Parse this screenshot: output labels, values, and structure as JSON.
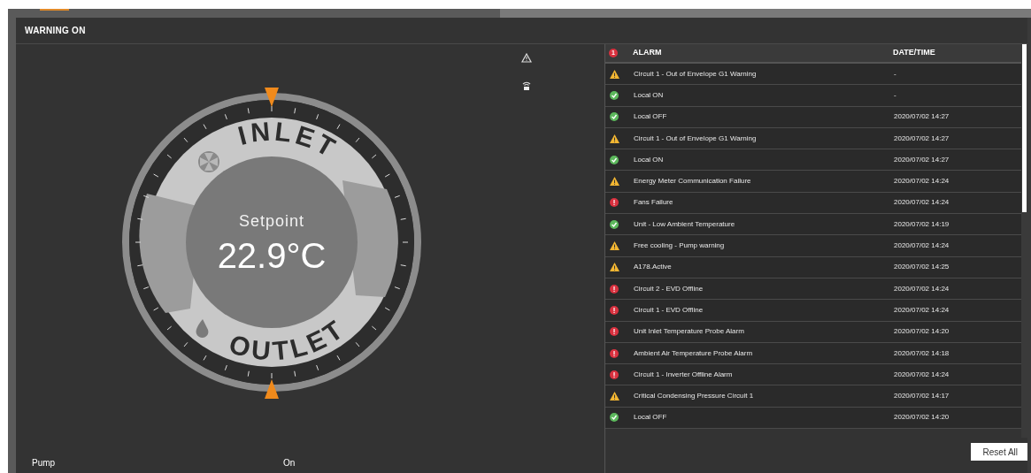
{
  "header": {
    "title": "WARNING ON"
  },
  "gauge": {
    "label": "Setpoint",
    "value": "22.9°C",
    "inlet": "INLET",
    "outlet": "OUTLET"
  },
  "status": {
    "label": "Pump",
    "value": "On"
  },
  "alarms": {
    "badge": "1",
    "columns": [
      "ALARM",
      "DATE/TIME"
    ],
    "rows": [
      {
        "kind": "warning",
        "alarm": "Circuit 1 - Out of Envelope G1 Warning",
        "time": "-"
      },
      {
        "kind": "ok",
        "alarm": "Local ON",
        "time": "-"
      },
      {
        "kind": "ok",
        "alarm": "Local OFF",
        "time": "2020/07/02 14:27"
      },
      {
        "kind": "warning",
        "alarm": "Circuit 1 - Out of Envelope G1 Warning",
        "time": "2020/07/02 14:27"
      },
      {
        "kind": "ok",
        "alarm": "Local ON",
        "time": "2020/07/02 14:27"
      },
      {
        "kind": "warning",
        "alarm": "Energy Meter Communication Failure",
        "time": "2020/07/02 14:24"
      },
      {
        "kind": "error",
        "alarm": "Fans Failure",
        "time": "2020/07/02 14:24"
      },
      {
        "kind": "ok",
        "alarm": "Unit - Low Ambient Temperature",
        "time": "2020/07/02 14:19"
      },
      {
        "kind": "warning",
        "alarm": "Free cooling - Pump warning",
        "time": "2020/07/02 14:24"
      },
      {
        "kind": "warning",
        "alarm": "A178.Active",
        "time": "2020/07/02 14:25"
      },
      {
        "kind": "error",
        "alarm": "Circuit 2 - EVD Offline",
        "time": "2020/07/02 14:24"
      },
      {
        "kind": "error",
        "alarm": "Circuit 1 - EVD Offline",
        "time": "2020/07/02 14:24"
      },
      {
        "kind": "error",
        "alarm": "Unit Inlet Temperature Probe Alarm",
        "time": "2020/07/02 14:20"
      },
      {
        "kind": "error",
        "alarm": "Ambient Air Temperature Probe Alarm",
        "time": "2020/07/02 14:18"
      },
      {
        "kind": "error",
        "alarm": "Circuit 1 - Inverter Offline Alarm",
        "time": "2020/07/02 14:24"
      },
      {
        "kind": "warning",
        "alarm": "Critical Condensing Pressure Circuit 1",
        "time": "2020/07/02 14:17"
      },
      {
        "kind": "ok",
        "alarm": "Local OFF",
        "time": "2020/07/02 14:20"
      }
    ],
    "reset": "Reset All"
  }
}
